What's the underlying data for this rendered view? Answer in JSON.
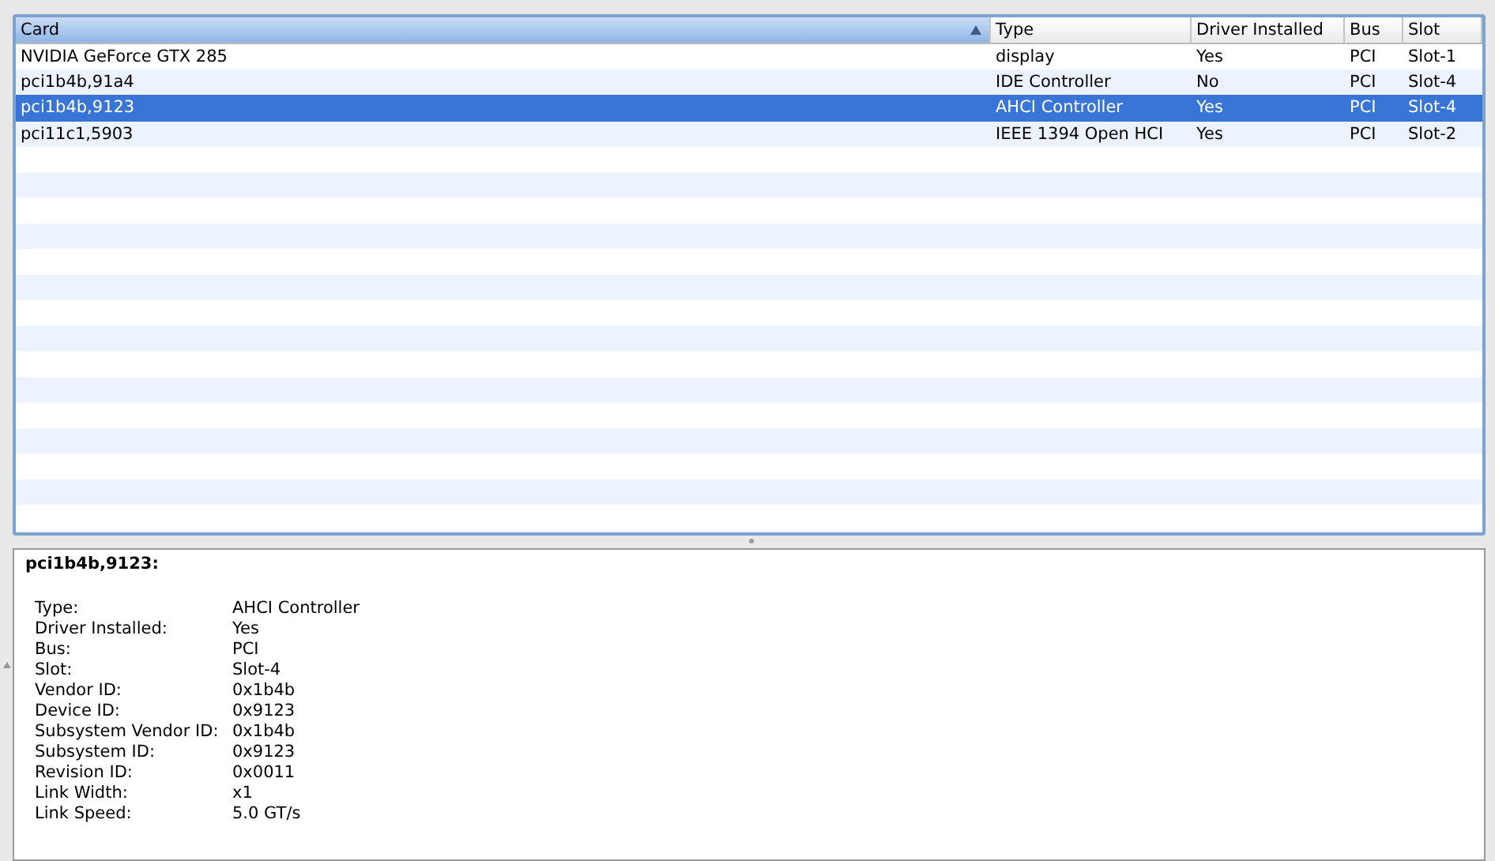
{
  "table": {
    "columns": [
      {
        "label": "Card",
        "sorted": true
      },
      {
        "label": "Type",
        "sorted": false
      },
      {
        "label": "Driver Installed",
        "sorted": false
      },
      {
        "label": "Bus",
        "sorted": false
      },
      {
        "label": "Slot",
        "sorted": false
      }
    ],
    "rows": [
      {
        "cells": [
          "NVIDIA GeForce GTX 285",
          "display",
          "Yes",
          "PCI",
          "Slot-1"
        ],
        "selected": false
      },
      {
        "cells": [
          "pci1b4b,91a4",
          "IDE Controller",
          "No",
          "PCI",
          "Slot-4"
        ],
        "selected": false
      },
      {
        "cells": [
          "pci1b4b,9123",
          "AHCI Controller",
          "Yes",
          "PCI",
          "Slot-4"
        ],
        "selected": true
      },
      {
        "cells": [
          "pci11c1,5903",
          "IEEE 1394 Open HCI",
          "Yes",
          "PCI",
          "Slot-2"
        ],
        "selected": false
      }
    ]
  },
  "detail": {
    "title": "pci1b4b,9123:",
    "properties": [
      {
        "label": "Type:",
        "value": "AHCI Controller"
      },
      {
        "label": "Driver Installed:",
        "value": "Yes"
      },
      {
        "label": "Bus:",
        "value": "PCI"
      },
      {
        "label": "Slot:",
        "value": "Slot-4"
      },
      {
        "label": "Vendor ID:",
        "value": "0x1b4b"
      },
      {
        "label": "Device ID:",
        "value": "0x9123"
      },
      {
        "label": "Subsystem Vendor ID:",
        "value": "0x1b4b"
      },
      {
        "label": "Subsystem ID:",
        "value": "0x9123"
      },
      {
        "label": "Revision ID:",
        "value": "0x0011"
      },
      {
        "label": "Link Width:",
        "value": "x1"
      },
      {
        "label": "Link Speed:",
        "value": "5.0 GT/s"
      }
    ]
  }
}
